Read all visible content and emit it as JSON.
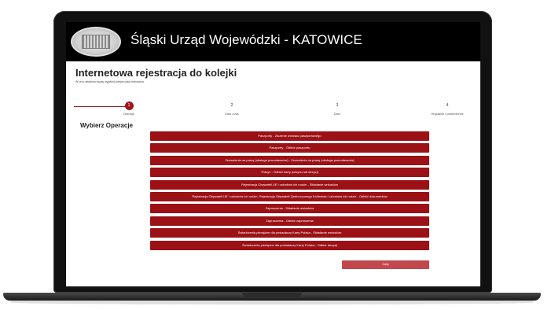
{
  "header": {
    "title": "Śląski Urząd Wojewódzki - KATOWICE"
  },
  "page": {
    "title": "Internetowa rejestracja do kolejki",
    "subtitle": "W celu ustalenia wizyty wypełnij kolejne pola formularza."
  },
  "stepper": {
    "steps": [
      {
        "number": "1",
        "label": "Operacje",
        "active": true
      },
      {
        "number": "2",
        "label": "Data i czas",
        "active": false
      },
      {
        "number": "3",
        "label": "Dane",
        "active": false
      },
      {
        "number": "4",
        "label": "Regulamin i potwierdzenie",
        "active": false
      }
    ]
  },
  "operations": {
    "title": "Wybierz Operacje",
    "items": [
      "Paszporty - Złożenie wniosku paszportowego",
      "Paszporty - Odbiór paszportu",
      "Zezwolenia na pracę (obsługa pracodawców) - Zezwolenia na pracę (obsługa pracodawców)",
      "Polsyn - Odbiór karty polsynu lub decyzji",
      "Rejestracja Obywateli UE i członków ich rodzin - Składanie wniosków",
      "Rejestracja Obywateli UE i członków ich rodzin, Rejestracja Obywateli Zjednoczonego Królestwa i członków ich rodzin - Odbiór dokumentów",
      "Zaproszenia - Składanie wniosków",
      "Zaproszenia - Odbiór zaproszenia",
      "Świadczenia pieniężne dla posiadaczy Karty Polaka - Składanie wniosków",
      "Świadczenia pieniężne dla posiadaczy Karty Polaka - Odbiór decyzji"
    ],
    "next_label": "Dalej"
  },
  "colors": {
    "accent": "#9b1116",
    "header": "#000000",
    "next_button": "#c2484d"
  }
}
